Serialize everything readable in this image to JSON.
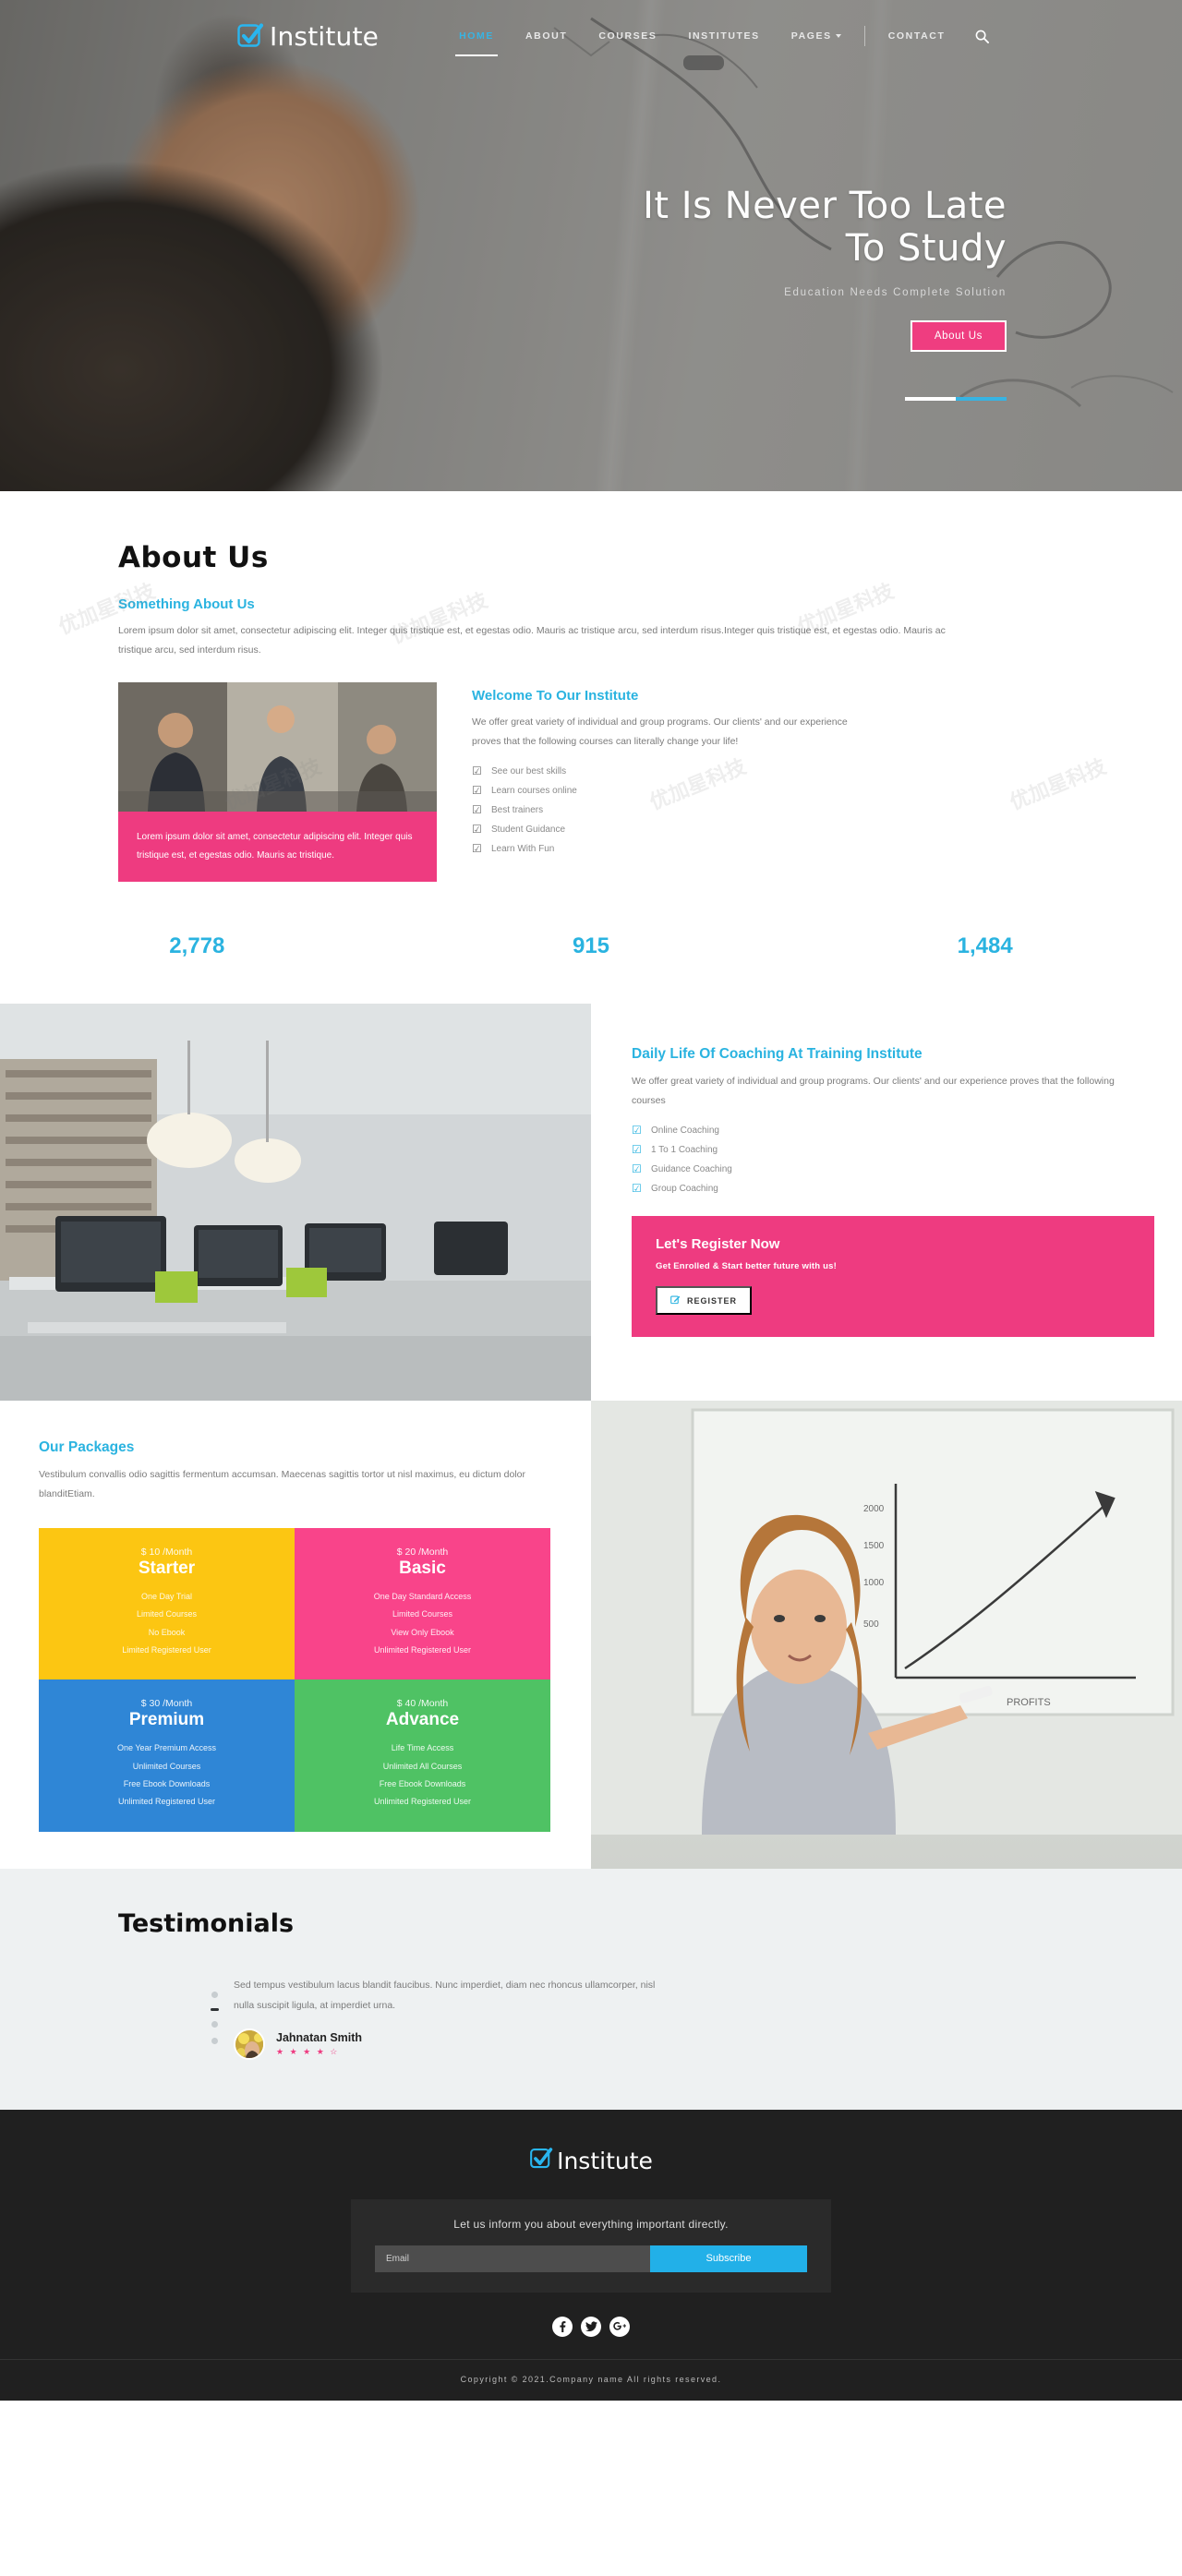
{
  "brand": {
    "name": "Institute",
    "mark_icon": "checkbox-check-icon"
  },
  "nav": {
    "items": [
      {
        "label": "HOME",
        "active": true
      },
      {
        "label": "ABOUT",
        "active": false
      },
      {
        "label": "COURSES",
        "active": false
      },
      {
        "label": "INSTITUTES",
        "active": false
      },
      {
        "label": "PAGES",
        "active": false,
        "has_caret": true
      },
      {
        "label": "CONTACT",
        "active": false
      }
    ],
    "search_icon": "search-icon"
  },
  "hero": {
    "title_line1": "It Is Never Too Late",
    "title_line2": "To Study",
    "subtitle": "Education Needs Complete Solution",
    "button": "About Us"
  },
  "about": {
    "title": "About Us",
    "subtitle": "Something About Us",
    "paragraph": "Lorem ipsum dolor sit amet, consectetur adipiscing elit. Integer quis tristique est, et egestas odio. Mauris ac tristique arcu, sed interdum risus.Integer quis tristique est, et egestas odio. Mauris ac tristique arcu, sed interdum risus.",
    "quote": "Lorem ipsum dolor sit amet, consectetur adipiscing elit. Integer quis tristique est, et egestas odio. Mauris ac tristique.",
    "welcome_title": "Welcome To Our Institute",
    "welcome_text": "We offer great variety of individual and group programs. Our clients' and our experience proves that the following courses can literally change your life!",
    "checklist": [
      "See our best skills",
      "Learn courses online",
      "Best trainers",
      "Student Guidance",
      "Learn With Fun"
    ]
  },
  "counters": [
    {
      "number": "2,778",
      "label": ""
    },
    {
      "number": "915",
      "label": ""
    },
    {
      "number": "1,484",
      "label": ""
    }
  ],
  "daily": {
    "title": "Daily Life Of Coaching At Training Institute",
    "text": "We offer great variety of individual and group programs. Our clients' and our experience proves that the following courses",
    "checklist": [
      "Online Coaching",
      "1 To 1 Coaching",
      "Guidance Coaching",
      "Group Coaching"
    ],
    "register": {
      "title": "Let's Register Now",
      "subtitle": "Get Enrolled & Start better future with us!",
      "button": "REGISTER",
      "button_icon": "edit-pencil-icon"
    }
  },
  "packages": {
    "title": "Our Packages",
    "text": "Vestibulum convallis odio sagittis fermentum accumsan. Maecenas sagittis tortor ut nisl maximus, eu dictum dolor blanditEtiam.",
    "items": [
      {
        "price": "$ 10 /Month",
        "name": "Starter",
        "color": "#fcc612",
        "features": [
          "One Day Trial",
          "Limited Courses",
          "No Ebook",
          "Limited Registered User"
        ]
      },
      {
        "price": "$ 20 /Month",
        "name": "Basic",
        "color": "#f9448a",
        "features": [
          "One Day Standard Access",
          "Limited Courses",
          "View Only Ebook",
          "Unlimited Registered User"
        ]
      },
      {
        "price": "$ 30 /Month",
        "name": "Premium",
        "color": "#2f86d6",
        "features": [
          "One Year Premium Access",
          "Unlimited Courses",
          "Free Ebook Downloads",
          "Unlimited Registered User"
        ]
      },
      {
        "price": "$ 40 /Month",
        "name": "Advance",
        "color": "#4fc264",
        "features": [
          "Life Time Access",
          "Unlimited All Courses",
          "Free Ebook Downloads",
          "Unlimited Registered User"
        ]
      }
    ]
  },
  "testimonials": {
    "title": "Testimonials",
    "quote": "Sed tempus vestibulum lacus blandit faucibus. Nunc imperdiet, diam nec rhoncus ullamcorper, nisl nulla suscipit ligula, at imperdiet urna.",
    "name": "Jahnatan Smith",
    "stars": "★ ★ ★ ★ ☆",
    "dot_count": 4,
    "active_dot": 1
  },
  "footer": {
    "brand": "Institute",
    "newsletter_text": "Let us inform you about everything important directly.",
    "email_placeholder": "Email",
    "email_value": "",
    "subscribe_label": "Subscribe",
    "socials": [
      {
        "name": "facebook-icon",
        "glyph": "f"
      },
      {
        "name": "twitter-icon",
        "glyph": "🐦"
      },
      {
        "name": "google-plus-icon",
        "glyph": "G⁺"
      }
    ],
    "copyright": "Copyright © 2021.Company name All rights reserved."
  },
  "colors": {
    "accent_blue": "#2ab3e0",
    "accent_pink": "#ee3b80",
    "dark": "#202020"
  }
}
